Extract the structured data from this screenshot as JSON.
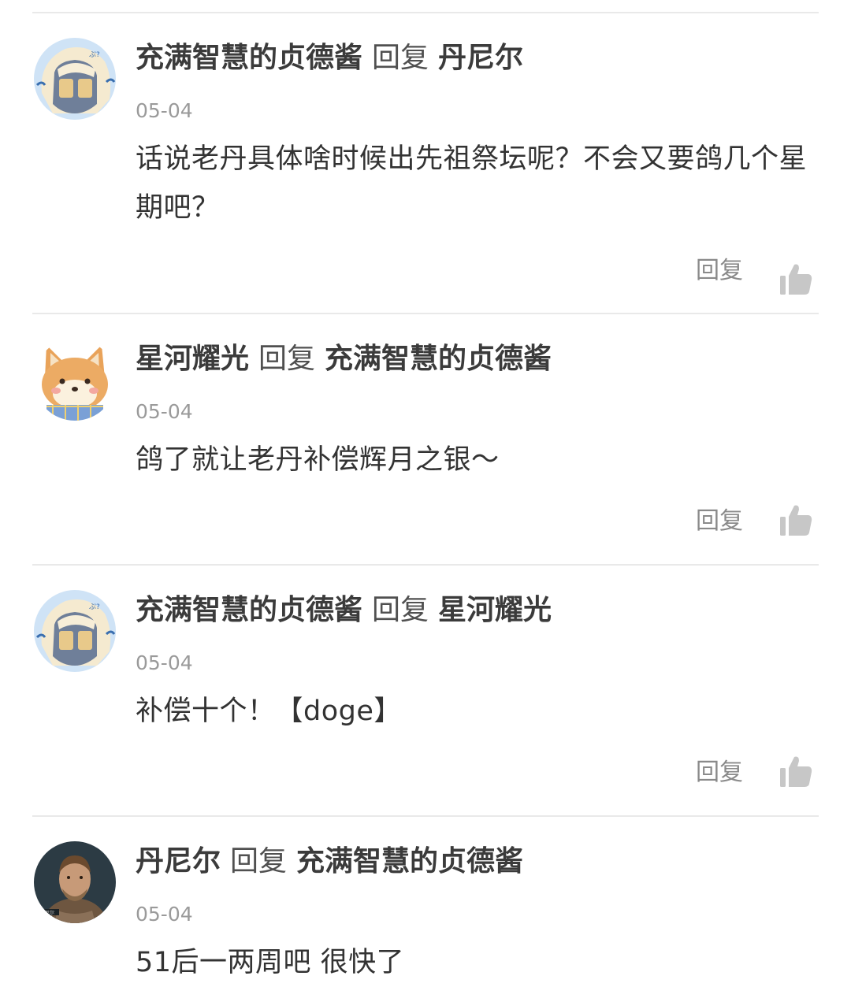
{
  "reply_word": "回复",
  "comments": [
    {
      "author": "充满智慧的贞德酱",
      "verb": "回复",
      "target": "丹尼尔",
      "date": "05-04",
      "text": "话说老丹具体啥时候出先祖祭坛呢？不会又要鸽几个星期吧？",
      "reply_label": "回复",
      "avatar_icon": "anime-girl-avatar-icon"
    },
    {
      "author": "星河耀光",
      "verb": "回复",
      "target": "充满智慧的贞德酱",
      "date": "05-04",
      "text": "鸽了就让老丹补偿辉月之银～",
      "reply_label": "回复",
      "avatar_icon": "shiba-dog-avatar-icon"
    },
    {
      "author": "充满智慧的贞德酱",
      "verb": "回复",
      "target": "星河耀光",
      "date": "05-04",
      "text": "补偿十个！【doge】",
      "reply_label": "回复",
      "avatar_icon": "anime-girl-avatar-icon"
    },
    {
      "author": "丹尼尔",
      "verb": "回复",
      "target": "充满智慧的贞德酱",
      "date": "05-04",
      "text": "51后一两周吧 很快了",
      "avatar_icon": "bearded-man-avatar-icon"
    }
  ],
  "colors": {
    "text": "#333333",
    "meta": "#9a9a9a",
    "divider": "#e9e9e9",
    "icon": "#c7c7c7"
  }
}
